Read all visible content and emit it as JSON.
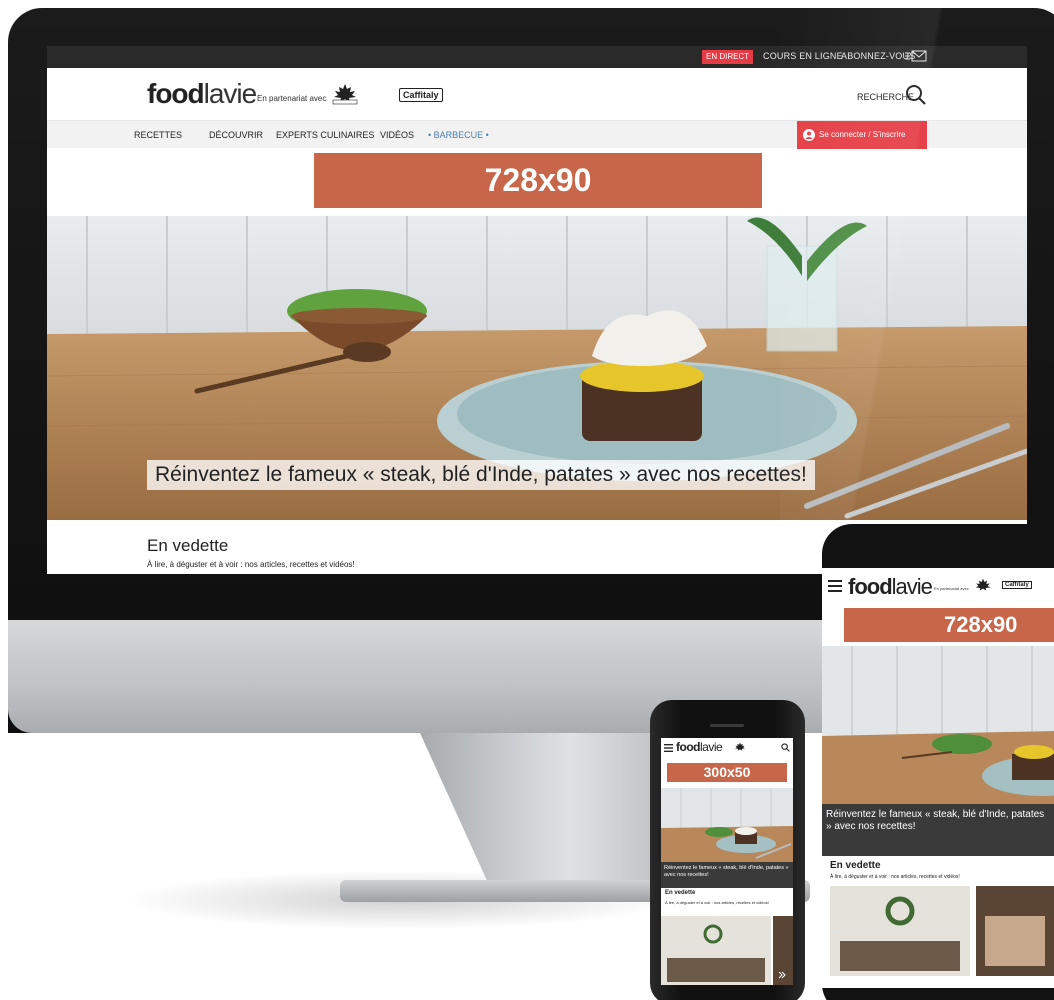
{
  "desktop": {
    "topbar": {
      "live_badge": "EN DIRECT",
      "courses_link": "COURS EN LIGNE",
      "subscribe_link": "ABONNEZ-VOUS"
    },
    "header": {
      "logo_bold": "food",
      "logo_light": "lavie",
      "partner_text": "En partenariat avec",
      "partner_brand": "Caffitaly",
      "search_label": "RECHERCHE"
    },
    "nav": {
      "items": [
        "RECETTES",
        "DÉCOUVRIR",
        "EXPERTS CULINAIRES",
        "VIDÉOS",
        "• BARBECUE •"
      ],
      "login_label": "Se connecter  /  S'inscrire"
    },
    "ad_label": "728x90",
    "hero_caption": "Réinventez le fameux « steak, blé d'Inde, patates » avec nos recettes!",
    "featured": {
      "title": "En vedette",
      "subtitle": "À lire, à déguster et à voir : nos articles, recettes et vidéos!"
    }
  },
  "tablet": {
    "logo_bold": "food",
    "logo_light": "lavie",
    "partner_text": "En partenariat avec",
    "partner_brand": "Caffitaly",
    "ad_label": "728x90",
    "hero_caption": "Réinventez le fameux « steak, blé d'Inde, patates » avec nos recettes!",
    "featured_title": "En vedette",
    "featured_subtitle": "À lire, à déguster et à voir : nos articles, recettes et vidéos!"
  },
  "phone": {
    "logo_bold": "food",
    "logo_light": "lavie",
    "ad_label": "300x50",
    "hero_caption": "Réinventez le fameux « steak, blé d'Inde, patates » avec nos recettes!",
    "featured_title": "En vedette",
    "featured_subtitle": "À lire, à déguster et à voir : nos articles, recettes et vidéos!"
  },
  "colors": {
    "ad_orange": "#c8664a",
    "login_red": "#e64048",
    "live_red": "#e63a45",
    "nav_accent": "#4a7da8",
    "topbar_dark": "#2a2a2a"
  },
  "icons": [
    "mail-icon",
    "search-icon",
    "user-icon",
    "menu-icon",
    "maple-leaf-icon",
    "chevron-right-icon"
  ]
}
